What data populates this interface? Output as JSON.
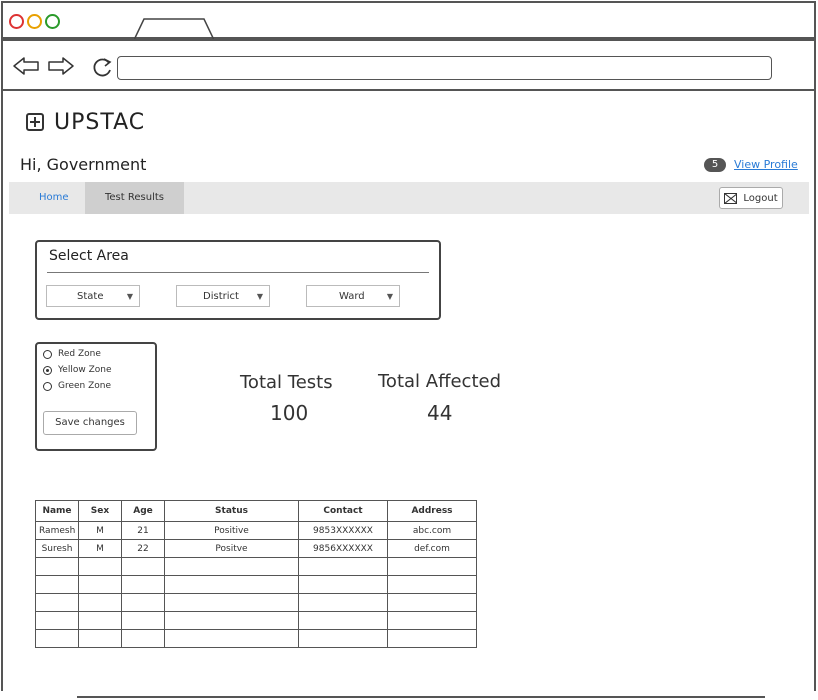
{
  "browser": {
    "url_value": ""
  },
  "header": {
    "app_title": "UPSTAC",
    "greeting": "Hi, Government",
    "notification_count": "5",
    "view_profile_label": "View Profile"
  },
  "nav": {
    "home_label": "Home",
    "test_results_label": "Test Results",
    "logout_label": "Logout"
  },
  "select_area": {
    "title": "Select Area",
    "state_label": "State",
    "district_label": "District",
    "ward_label": "Ward"
  },
  "zones": {
    "options": [
      "Red Zone",
      "Yellow Zone",
      "Green Zone"
    ],
    "selected": "Yellow Zone",
    "save_label": "Save changes"
  },
  "stats": {
    "total_tests_label": "Total Tests",
    "total_tests_value": "100",
    "total_affected_label": "Total Affected",
    "total_affected_value": "44"
  },
  "table": {
    "headers": [
      "Name",
      "Sex",
      "Age",
      "Status",
      "Contact",
      "Address"
    ],
    "rows": [
      [
        "Ramesh",
        "M",
        "21",
        "Positive",
        "9853XXXXXX",
        "abc.com"
      ],
      [
        "Suresh",
        "M",
        "22",
        "Positve",
        "9856XXXXXX",
        "def.com"
      ],
      [
        "",
        "",
        "",
        "",
        "",
        ""
      ],
      [
        "",
        "",
        "",
        "",
        "",
        ""
      ],
      [
        "",
        "",
        "",
        "",
        "",
        ""
      ],
      [
        "",
        "",
        "",
        "",
        "",
        ""
      ],
      [
        "",
        "",
        "",
        "",
        "",
        ""
      ]
    ]
  }
}
